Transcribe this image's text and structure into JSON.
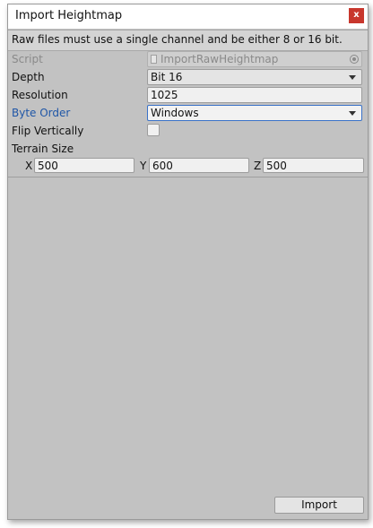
{
  "window": {
    "title": "Import Heightmap",
    "close_glyph": "x"
  },
  "help": {
    "message": "Raw files must use a single channel and be either 8 or 16 bit."
  },
  "fields": {
    "script": {
      "label": "Script",
      "value": "ImportRawHeightmap",
      "icon": "script-file-icon"
    },
    "depth": {
      "label": "Depth",
      "value": "Bit 16"
    },
    "resolution": {
      "label": "Resolution",
      "value": "1025"
    },
    "byte_order": {
      "label": "Byte Order",
      "value": "Windows"
    },
    "flip_vertically": {
      "label": "Flip Vertically",
      "checked": false
    },
    "terrain_size": {
      "label": "Terrain Size",
      "x_label": "X",
      "x_value": "500",
      "y_label": "Y",
      "y_value": "600",
      "z_label": "Z",
      "z_value": "500"
    }
  },
  "actions": {
    "import_label": "Import"
  },
  "colors": {
    "panel_bg": "#c2c2c2",
    "highlight_label": "#1f56a7",
    "close_button": "#c8372d"
  }
}
